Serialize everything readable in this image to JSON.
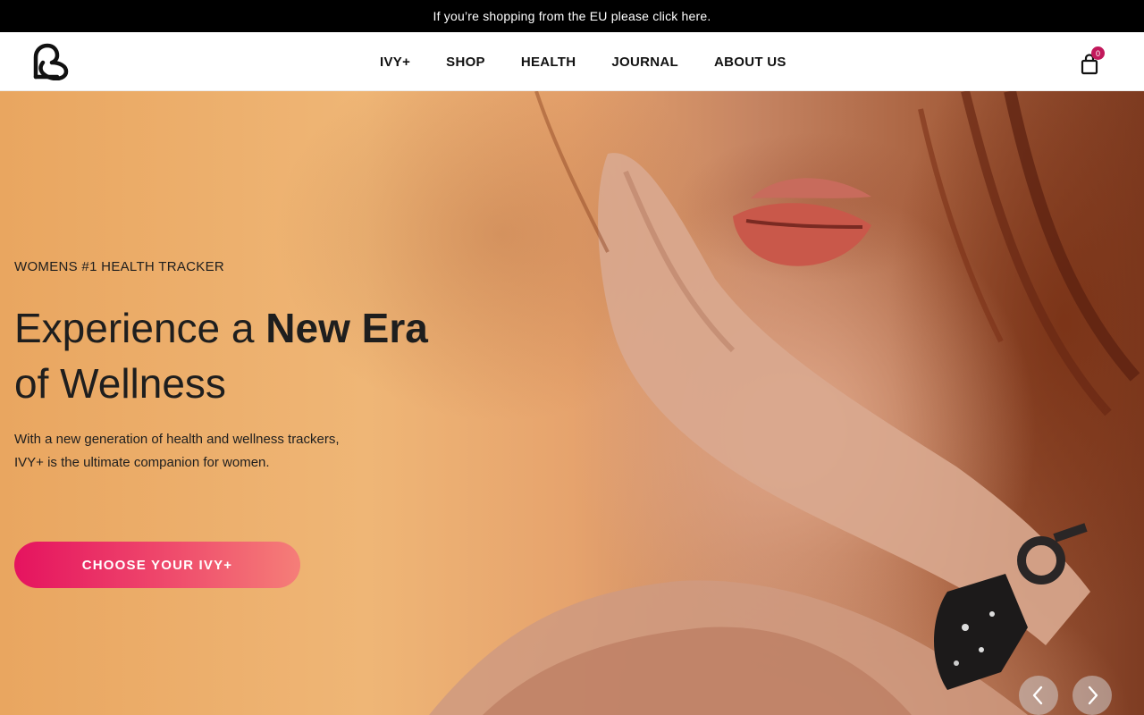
{
  "promo": {
    "text": "If you’re shopping from the EU please click here."
  },
  "header": {
    "logo_icon": "ivy-heart-logo-icon",
    "nav": [
      {
        "label": "IVY+"
      },
      {
        "label": "SHOP"
      },
      {
        "label": "HEALTH"
      },
      {
        "label": "JOURNAL"
      },
      {
        "label": "ABOUT US"
      }
    ],
    "cart": {
      "icon": "shopping-bag-icon",
      "count": "0"
    }
  },
  "hero": {
    "eyebrow": "WOMENS #1 HEALTH TRACKER",
    "headline_part1": "Experience a ",
    "headline_bold": "New Era",
    "headline_part2": "of Wellness",
    "subtext_line1": "With a new generation of health and wellness trackers,",
    "subtext_line2": "IVY+ is the ultimate companion for women.",
    "cta_label": "CHOOSE YOUR IVY+",
    "cta_gradient": [
      "#e5135f",
      "#f57e78"
    ],
    "prev_icon": "chevron-left-icon",
    "next_icon": "chevron-right-icon"
  },
  "colors": {
    "promo_bg": "#000000",
    "badge": "#c2185b",
    "text": "#1e1e1e"
  }
}
